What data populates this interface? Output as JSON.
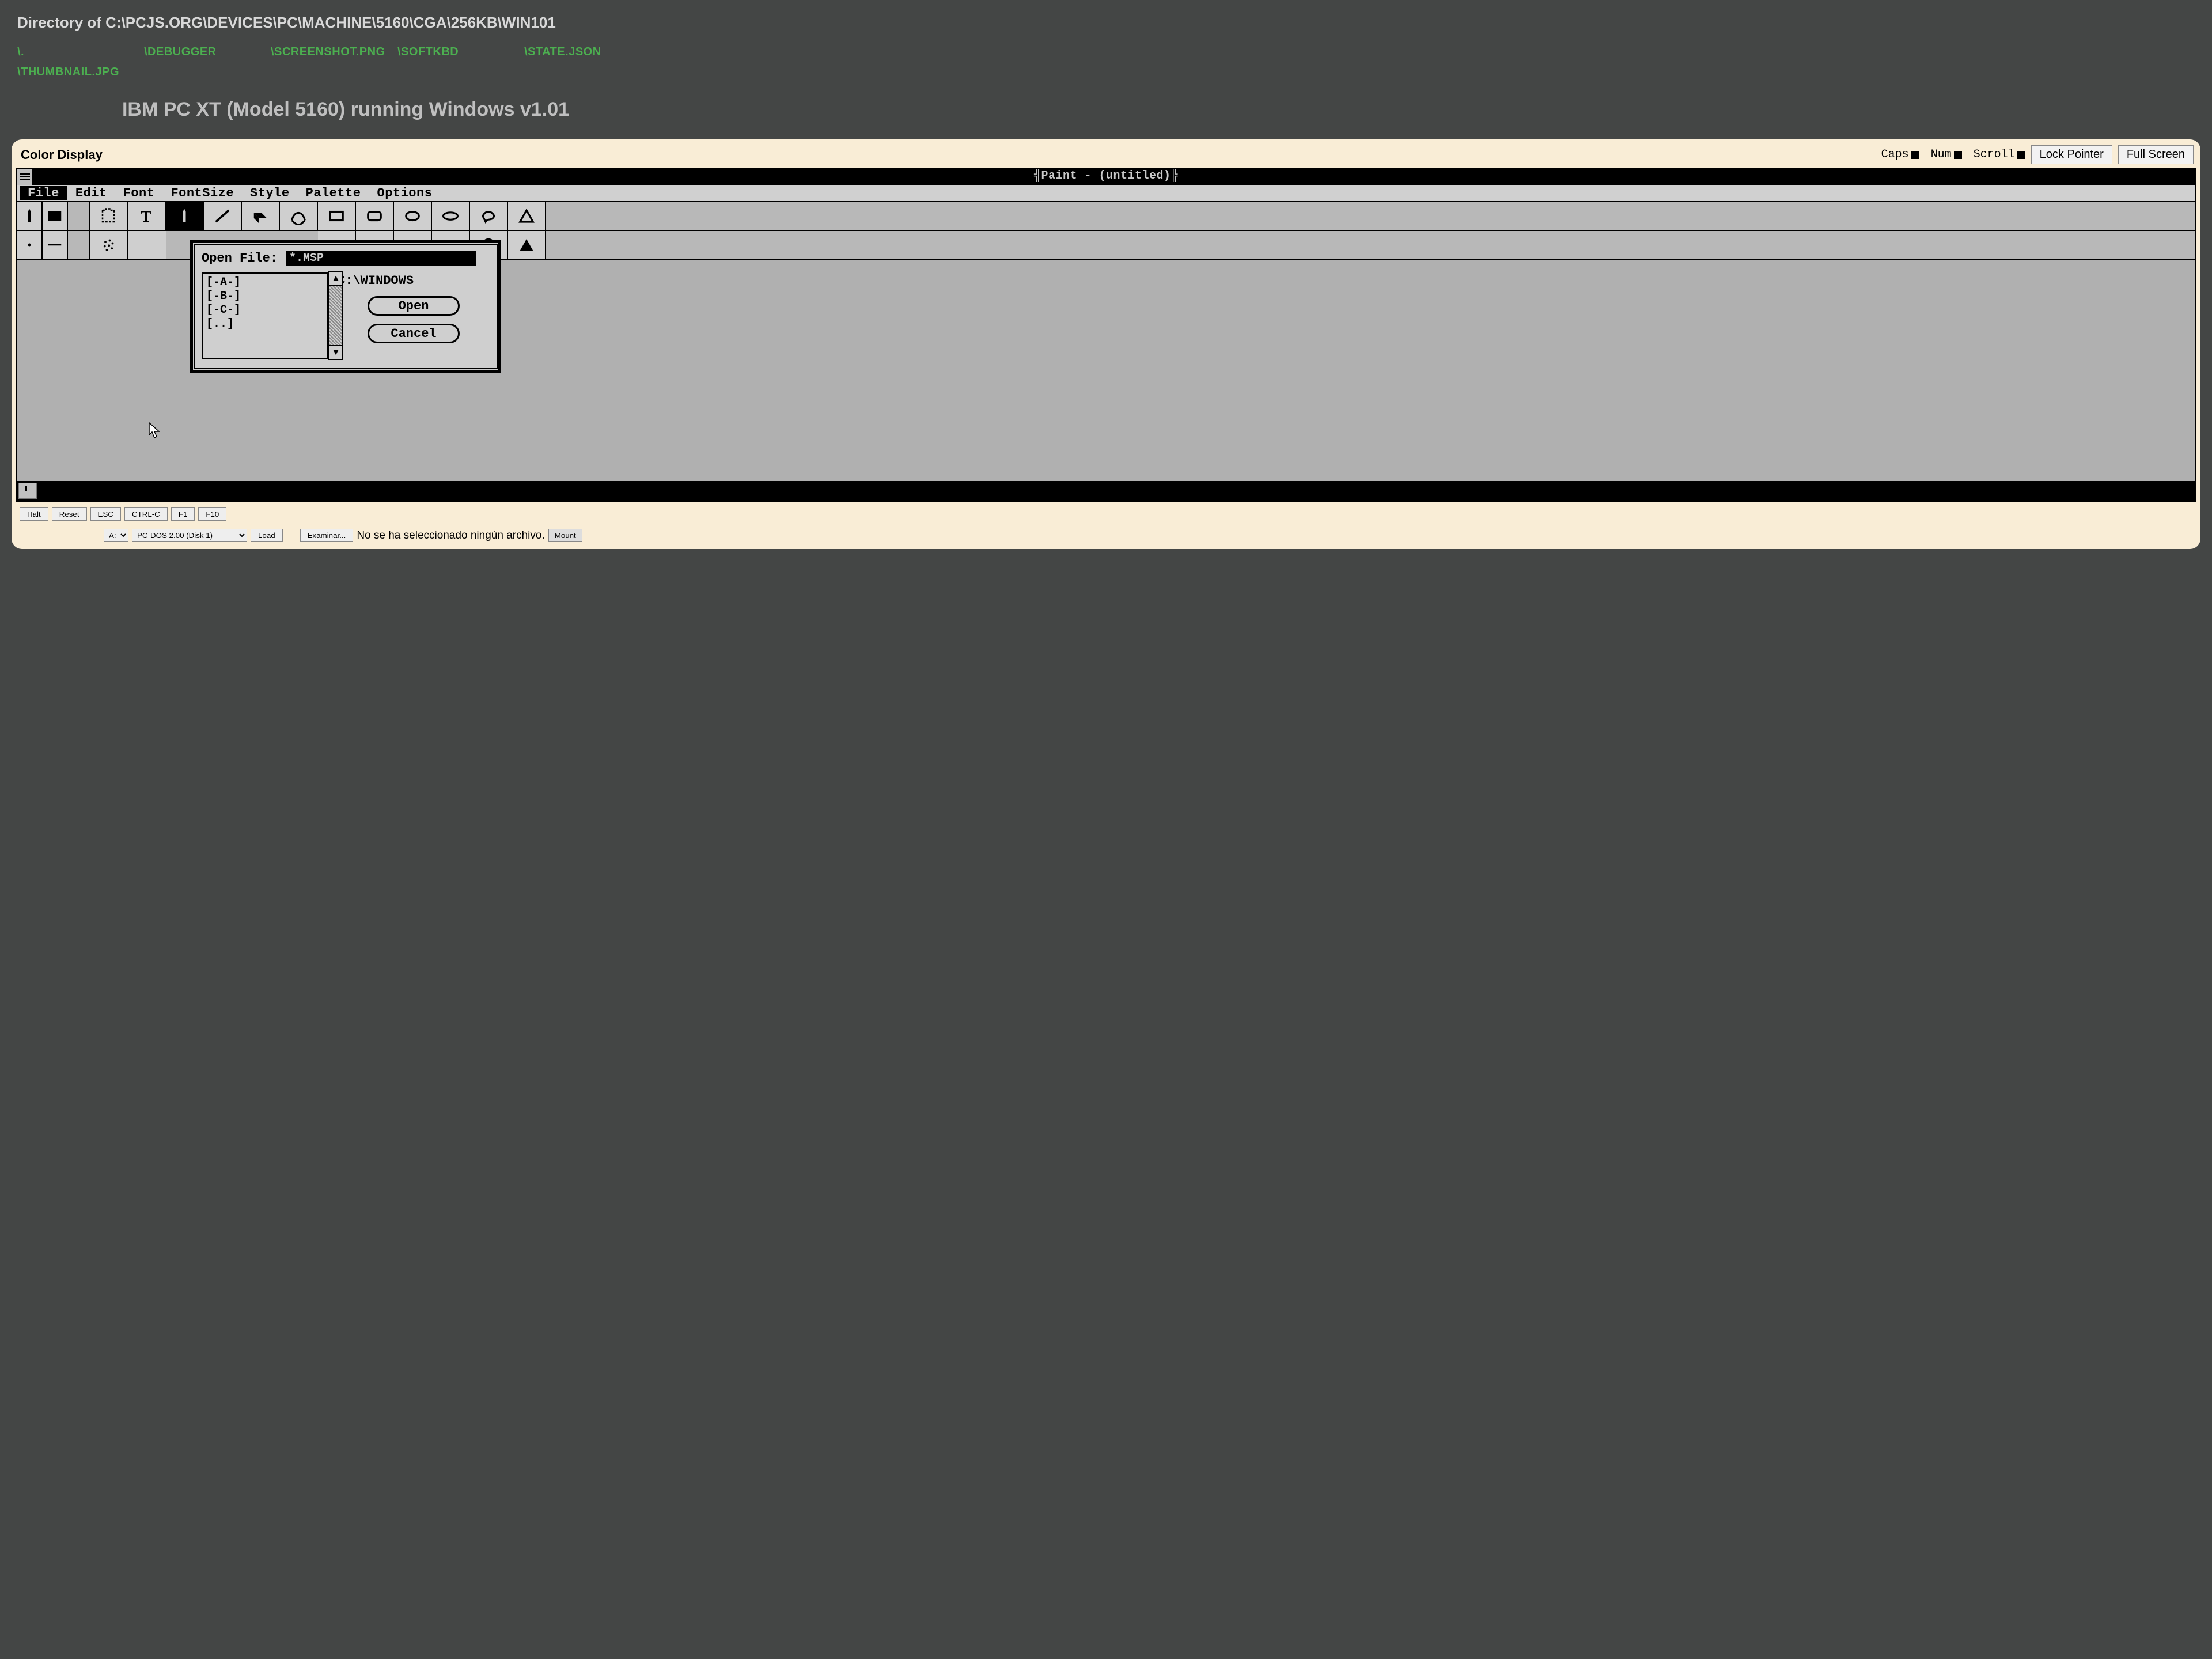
{
  "directory": {
    "heading": "Directory of C:\\PCJS.ORG\\DEVICES\\PC\\MACHINE\\5160\\CGA\\256KB\\WIN101",
    "links": [
      "\\.",
      "\\DEBUGGER",
      "\\SCREENSHOT.PNG",
      "\\SOFTKBD",
      "\\STATE.JSON",
      "\\THUMBNAIL.JPG"
    ]
  },
  "page_title": "IBM PC XT (Model 5160) running Windows v1.01",
  "emu_header": {
    "display_label": "Color Display",
    "locks": [
      "Caps",
      "Num",
      "Scroll"
    ],
    "lock_pointer": "Lock Pointer",
    "full_screen": "Full Screen"
  },
  "guest": {
    "title": "Paint - (untitled)",
    "menus": [
      "File",
      "Edit",
      "Font",
      "FontSize",
      "Style",
      "Palette",
      "Options"
    ],
    "dialog": {
      "label": "Open File:",
      "input_value": "*.MSP",
      "path": "C:\\WINDOWS",
      "files": [
        "[-A-]",
        "[-B-]",
        "[-C-]",
        "[..]"
      ],
      "open": "Open",
      "cancel": "Cancel"
    }
  },
  "controls": {
    "buttons": [
      "Halt",
      "Reset",
      "ESC",
      "CTRL-C",
      "F1",
      "F10"
    ],
    "drive_options": [
      "A:"
    ],
    "drive_selected": "A:",
    "disk_options": [
      "PC-DOS 2.00 (Disk 1)"
    ],
    "disk_selected": "PC-DOS 2.00 (Disk 1)",
    "load": "Load",
    "browse": "Examinar...",
    "file_status": "No se ha seleccionado ningún archivo.",
    "mount": "Mount"
  }
}
